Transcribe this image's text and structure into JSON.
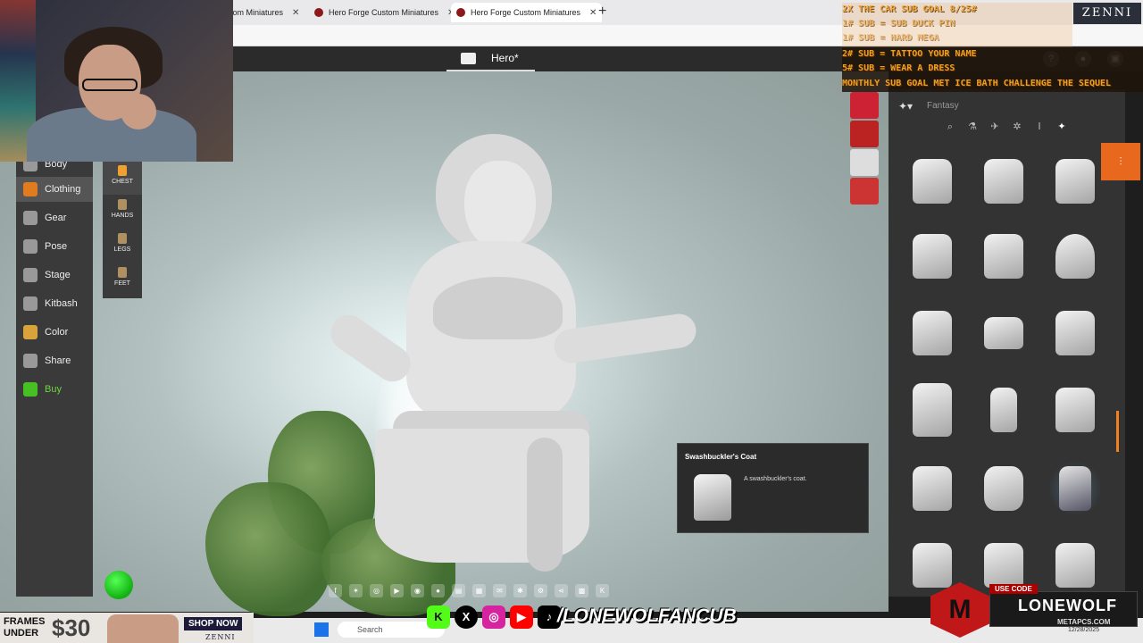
{
  "browser": {
    "tabs": [
      {
        "label": "tom Miniatures"
      },
      {
        "label": "Hero Forge Custom Miniatures"
      },
      {
        "label": "Hero Forge Custom Miniatures"
      }
    ],
    "new_tab_glyph": "+"
  },
  "app": {
    "title": "Hero*",
    "header_icons": [
      "help-icon",
      "account-icon",
      "cart-icon"
    ]
  },
  "left_menu": {
    "items": [
      {
        "label": "Body",
        "icon": "body-icon"
      },
      {
        "label": "Clothing",
        "icon": "shirt-icon"
      },
      {
        "label": "Gear",
        "icon": "weapons-icon"
      },
      {
        "label": "Pose",
        "icon": "pose-icon"
      },
      {
        "label": "Stage",
        "icon": "stage-icon"
      },
      {
        "label": "Kitbash",
        "icon": "kitbash-icon"
      },
      {
        "label": "Color",
        "icon": "palette-icon"
      },
      {
        "label": "Share",
        "icon": "share-icon"
      },
      {
        "label": "Buy",
        "icon": "cart-icon"
      }
    ],
    "active": "Clothing"
  },
  "sub_menu": {
    "items": [
      {
        "label": "CHEST"
      },
      {
        "label": "HANDS"
      },
      {
        "label": "LEGS"
      },
      {
        "label": "FEET"
      }
    ],
    "active": "CHEST"
  },
  "right_panel": {
    "category": "Fantasy",
    "filters": [
      "search-icon",
      "potion-icon",
      "sci-fi-icon",
      "steampunk-icon",
      "modern-icon",
      "fantasy-icon"
    ]
  },
  "tooltip": {
    "title": "Swashbuckler's Coat",
    "description": "A swashbuckler's coat."
  },
  "stream_overlay": {
    "goals": [
      "2X THE CAR SUB GOAL 8/25#",
      "1# SUB = SUB DUCK PIN",
      "1# SUB = HARD MEGA",
      "2# SUB = TATTOO YOUR NAME",
      "5# SUB = WEAR A DRESS",
      "MONTHLY SUB GOAL MET ICE BATH CHALLENGE THE SEQUEL"
    ],
    "sponsor": "ZENNI",
    "ad": {
      "line1": "FRAMES",
      "line2": "UNDER",
      "price": "$30",
      "cta": "SHOP NOW",
      "brand": "ZENNI"
    },
    "social_handle": "/LONEWOLFANCUB",
    "promo": {
      "code_label": "USE CODE",
      "code": "LONEWOLF",
      "url": "METAPCS.COM"
    }
  },
  "taskbar": {
    "search_placeholder": "Search",
    "date": "12/28/2025"
  }
}
